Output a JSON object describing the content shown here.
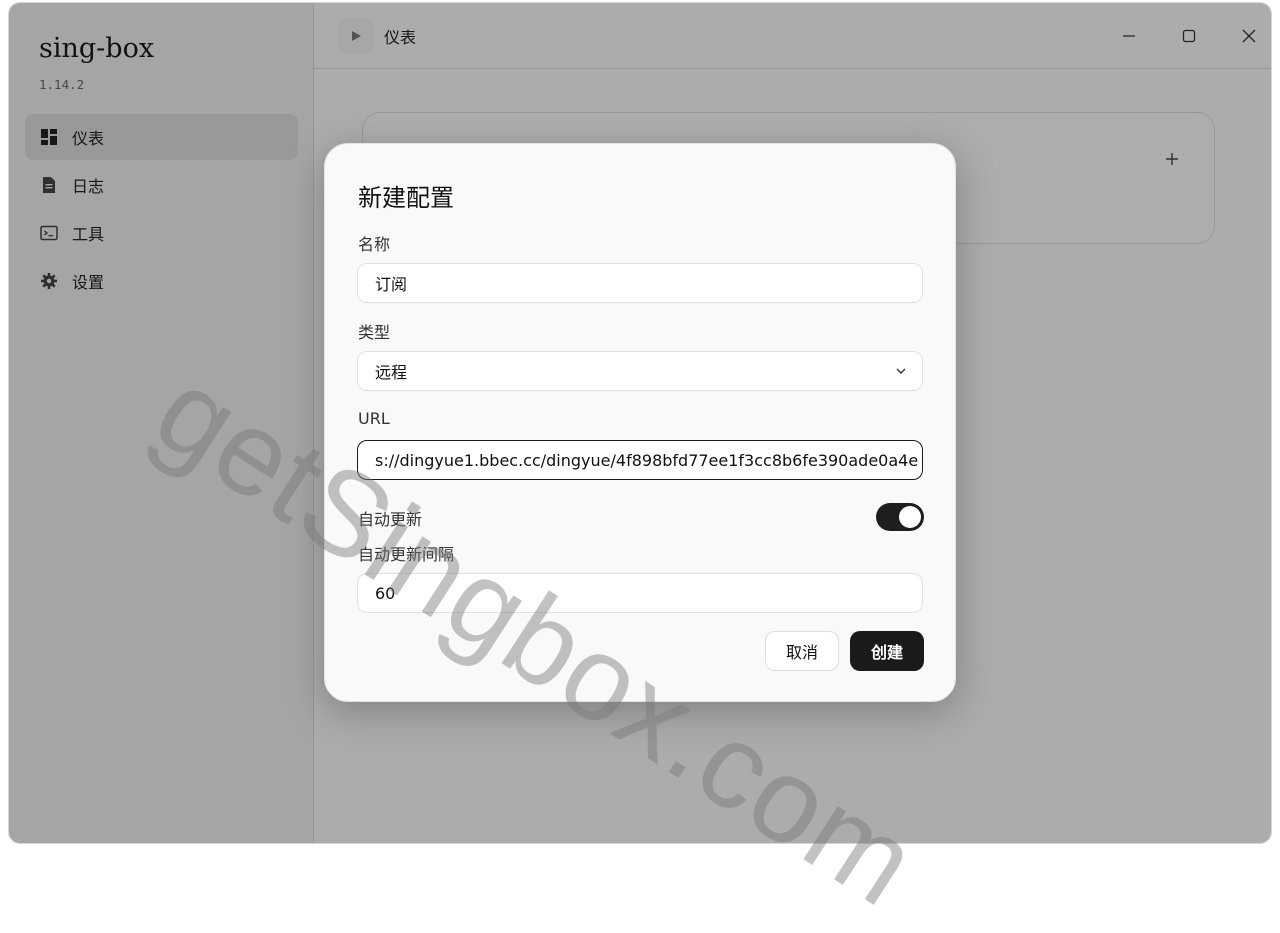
{
  "app": {
    "name": "sing-box",
    "version": "1.14.2"
  },
  "sidebar": {
    "items": [
      {
        "label": "仪表",
        "icon": "dashboard-icon",
        "active": true
      },
      {
        "label": "日志",
        "icon": "document-icon",
        "active": false
      },
      {
        "label": "工具",
        "icon": "terminal-icon",
        "active": false
      },
      {
        "label": "设置",
        "icon": "gear-icon",
        "active": false
      }
    ]
  },
  "header": {
    "title": "仪表"
  },
  "window_controls": {
    "minimize_icon": "minimize-icon",
    "maximize_icon": "maximize-icon",
    "close_icon": "close-icon"
  },
  "card": {
    "add_icon": "plus-icon"
  },
  "dialog": {
    "title": "新建配置",
    "name_label": "名称",
    "name_value": "订阅",
    "type_label": "类型",
    "type_value": "远程",
    "url_label": "URL",
    "url_value": "s://dingyue1.bbec.cc/dingyue/4f898bfd77ee1f3cc8b6fe390ade0a4e",
    "auto_update_label": "自动更新",
    "auto_update_on": true,
    "interval_label": "自动更新间隔",
    "interval_value": "60",
    "cancel_label": "取消",
    "create_label": "创建"
  },
  "watermark": "getSingbox.com"
}
